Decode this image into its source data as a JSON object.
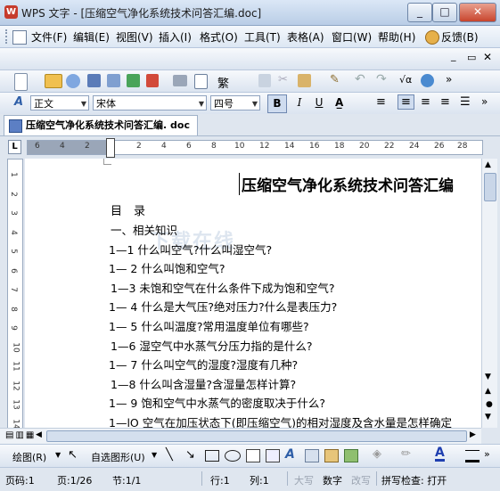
{
  "titlebar": {
    "title": "WPS 文字 - [压缩空气净化系统技术问答汇编.doc]"
  },
  "menu": {
    "items": [
      "文件(F)",
      "编辑(E)",
      "视图(V)",
      "插入(I)",
      "格式(O)",
      "工具(T)",
      "表格(A)",
      "窗口(W)",
      "帮助(H)"
    ],
    "feedback": "反馈(B)"
  },
  "format_toolbar": {
    "style": "正文",
    "font": "宋体",
    "size": "四号",
    "bold": "B",
    "italic": "I",
    "underline": "U"
  },
  "tab": {
    "label": "压缩空气净化系统技术问答汇编. doc"
  },
  "ruler": {
    "corner": "L",
    "numbers": [
      "6",
      "4",
      "2",
      "2",
      "4",
      "6",
      "8",
      "10",
      "12",
      "14",
      "16",
      "18",
      "20",
      "22",
      "24",
      "26",
      "28"
    ]
  },
  "vruler": {
    "numbers": [
      "1",
      "2",
      "3",
      "4",
      "5",
      "6",
      "7",
      "8",
      "9",
      "10",
      "11",
      "12",
      "13",
      "14"
    ]
  },
  "document": {
    "heading": "压缩空气净化系统技术问答汇编",
    "toc_title": "目　录",
    "lines": [
      "一、相关知识",
      "1—1 什么叫空气?什么叫湿空气?",
      "1— 2 什么叫饱和空气?",
      "1—3 未饱和空气在什么条件下成为饱和空气?",
      "1— 4 什么是大气压?绝对压力?什么是表压力?",
      "1— 5 什么叫温度?常用温度单位有哪些?",
      "1—6 湿空气中水蒸气分压力指的是什么?",
      "1— 7 什么叫空气的湿度?湿度有几种?",
      "1—8 什么叫含湿量?含湿量怎样计算?",
      "1— 9 饱和空气中水蒸气的密度取决于什么?",
      "1—lO 空气在加压状态下(即压缩空气)的相对湿度及含水量是怎样确定"
    ],
    "watermark": "下载在线"
  },
  "draw_toolbar": {
    "draw": "绘图(R)",
    "autoshape": "自选图形(U)"
  },
  "status": {
    "page_code": "页码:1",
    "page": "页:1/26",
    "section": "节:1/1",
    "row": "行:1",
    "col": "列:1",
    "caps": "大写",
    "num": "数字",
    "ovr": "改写",
    "spell": "拼写检查: 打开"
  },
  "colors": {
    "accent": "#2f5fa8",
    "font_color": "#1f3fb0"
  }
}
